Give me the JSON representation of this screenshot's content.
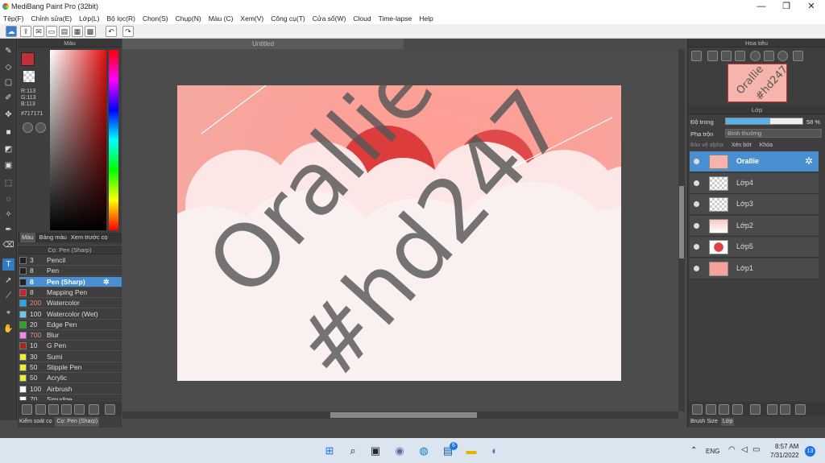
{
  "window": {
    "title": "MediBang Paint Pro (32bit)",
    "min": "—",
    "max": "❐",
    "close": "✕"
  },
  "menu": [
    "Tệp(F)",
    "Chỉnh sửa(E)",
    "Lớp(L)",
    "Bộ lọc(R)",
    "Chọn(S)",
    "Chụp(N)",
    "Màu (C)",
    "Xem(V)",
    "Công cụ(T)",
    "Cửa sổ(W)",
    "Cloud",
    "Time-lapse",
    "Help"
  ],
  "color_panel": {
    "title": "Màu",
    "rgb_r": "R:113",
    "rgb_g": "G:113",
    "rgb_b": "B:113",
    "hex": "#717171",
    "tabs": [
      "Màu",
      "Bảng màu",
      "Xem trước cọ"
    ],
    "primary": "#c0303a",
    "secondary": "#ffffff"
  },
  "brush_panel": {
    "title": "Cọ: Pen (Sharp)",
    "bottom_tabs": [
      "Kiểm soát cọ",
      "Cọ: Pen (Sharp)"
    ],
    "items": [
      {
        "size": "3",
        "name": "Pencil",
        "color": "#222222",
        "selected": false
      },
      {
        "size": "8",
        "name": "Pen",
        "color": "#222222",
        "selected": false
      },
      {
        "size": "8",
        "name": "Pen (Sharp)",
        "color": "#222222",
        "selected": true
      },
      {
        "size": "8",
        "name": "Mapping Pen",
        "color": "#d02030",
        "selected": false
      },
      {
        "size": "200",
        "name": "Watercolor",
        "color": "#22aaee",
        "selected": false
      },
      {
        "size": "100",
        "name": "Watercolor (Wet)",
        "color": "#66ccee",
        "selected": false
      },
      {
        "size": "20",
        "name": "Edge Pen",
        "color": "#22aa22",
        "selected": false
      },
      {
        "size": "700",
        "name": "Blur",
        "color": "#ee88ee",
        "selected": false
      },
      {
        "size": "10",
        "name": "G Pen",
        "color": "#aa2222",
        "selected": false
      },
      {
        "size": "30",
        "name": "Sumi",
        "color": "#eeee33",
        "selected": false
      },
      {
        "size": "50",
        "name": "Stipple Pen",
        "color": "#eeee33",
        "selected": false
      },
      {
        "size": "50",
        "name": "Acrylic",
        "color": "#eeee33",
        "selected": false
      },
      {
        "size": "100",
        "name": "Airbrush",
        "color": "#ffffff",
        "selected": false
      },
      {
        "size": "70",
        "name": "Smudge",
        "color": "#ffffff",
        "selected": false
      }
    ]
  },
  "document": {
    "tab": "Untitled",
    "line1": "Orallie",
    "line2": "#hd247"
  },
  "navigator": {
    "title": "Hoa tiêu"
  },
  "layer_panel": {
    "title": "Lớp",
    "opacity_label": "Độ trong",
    "opacity_value": "58 %",
    "opacity_fraction": 0.58,
    "blend_label": "Pha trộn",
    "blend_value": "Bình thường",
    "protect_alpha": "Bảo vệ alpha",
    "clipping": "Xén bớt",
    "lock": "Khóa",
    "layers": [
      {
        "name": "Orallie",
        "selected": true,
        "thumb": "text"
      },
      {
        "name": "Lớp4",
        "selected": false,
        "thumb": "checker"
      },
      {
        "name": "Lớp3",
        "selected": false,
        "thumb": "checker"
      },
      {
        "name": "Lớp2",
        "selected": false,
        "thumb": "pinkish"
      },
      {
        "name": "Lớp5",
        "selected": false,
        "thumb": "red"
      },
      {
        "name": "Lớp1",
        "selected": false,
        "thumb": "pink"
      }
    ],
    "bottom_tabs": [
      "Brush Size",
      "Lớp"
    ]
  },
  "taskbar": {
    "lang": "ENG",
    "time": "8:57 AM",
    "date": "7/31/2022",
    "badge": "13",
    "edge_badge": "6"
  }
}
